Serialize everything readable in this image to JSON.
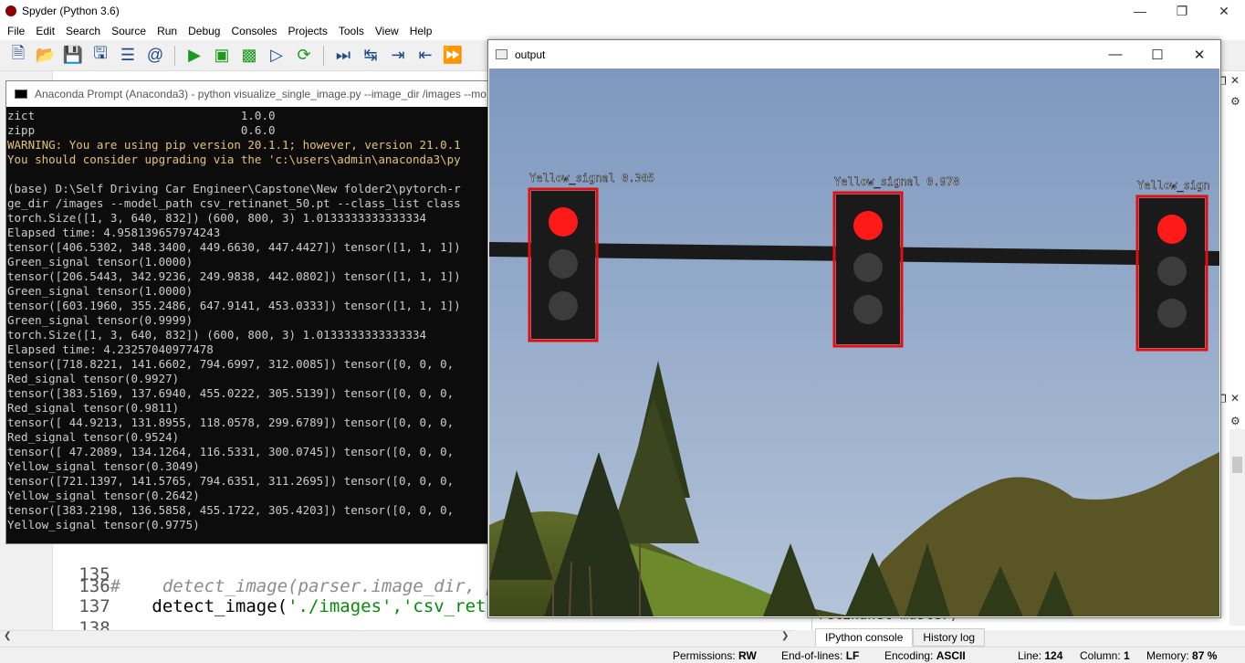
{
  "window": {
    "title": "Spyder (Python 3.6)",
    "controls": [
      "—",
      "❐",
      "✕"
    ]
  },
  "menu": [
    "File",
    "Edit",
    "Search",
    "Source",
    "Run",
    "Debug",
    "Consoles",
    "Projects",
    "Tools",
    "View",
    "Help"
  ],
  "editor": {
    "lines": [
      {
        "num": "135",
        "code": ""
      },
      {
        "num": "136",
        "code": "#    detect_image(parser.image_dir, parser.m"
      },
      {
        "num": "137",
        "code_prefix": "    detect_image(",
        "code_str": "'./images','csv_retinanet_",
        "code_suffix": ""
      },
      {
        "num": "138",
        "code": ""
      }
    ]
  },
  "prompt": {
    "title": "Anaconda Prompt (Anaconda3) - python  visualize_single_image.py --image_dir /images --mo",
    "lines": [
      {
        "text": "zict                              1.0.0",
        "warn": false
      },
      {
        "text": "zipp                              0.6.0",
        "warn": false
      },
      {
        "text": "WARNING: You are using pip version 20.1.1; however, version 21.0.1",
        "warn": true
      },
      {
        "text": "You should consider upgrading via the 'c:\\users\\admin\\anaconda3\\py",
        "warn": true
      },
      {
        "text": "",
        "warn": false
      },
      {
        "text": "(base) D:\\Self Driving Car Engineer\\Capstone\\New folder2\\pytorch-r",
        "warn": false
      },
      {
        "text": "ge_dir /images --model_path csv_retinanet_50.pt --class_list class",
        "warn": false
      },
      {
        "text": "torch.Size([1, 3, 640, 832]) (600, 800, 3) 1.0133333333333334",
        "warn": false
      },
      {
        "text": "Elapsed time: 4.958139657974243",
        "warn": false
      },
      {
        "text": "tensor([406.5302, 348.3400, 449.6630, 447.4427]) tensor([1, 1, 1])",
        "warn": false
      },
      {
        "text": "Green_signal tensor(1.0000)",
        "warn": false
      },
      {
        "text": "tensor([206.5443, 342.9236, 249.9838, 442.0802]) tensor([1, 1, 1])",
        "warn": false
      },
      {
        "text": "Green_signal tensor(1.0000)",
        "warn": false
      },
      {
        "text": "tensor([603.1960, 355.2486, 647.9141, 453.0333]) tensor([1, 1, 1])",
        "warn": false
      },
      {
        "text": "Green_signal tensor(0.9999)",
        "warn": false
      },
      {
        "text": "torch.Size([1, 3, 640, 832]) (600, 800, 3) 1.0133333333333334",
        "warn": false
      },
      {
        "text": "Elapsed time: 4.23257040977478",
        "warn": false
      },
      {
        "text": "tensor([718.8221, 141.6602, 794.6997, 312.0085]) tensor([0, 0, 0,",
        "warn": false
      },
      {
        "text": "Red_signal tensor(0.9927)",
        "warn": false
      },
      {
        "text": "tensor([383.5169, 137.6940, 455.0222, 305.5139]) tensor([0, 0, 0,",
        "warn": false
      },
      {
        "text": "Red_signal tensor(0.9811)",
        "warn": false
      },
      {
        "text": "tensor([ 44.9213, 131.8955, 118.0578, 299.6789]) tensor([0, 0, 0,",
        "warn": false
      },
      {
        "text": "Red_signal tensor(0.9524)",
        "warn": false
      },
      {
        "text": "tensor([ 47.2089, 134.1264, 116.5331, 300.0745]) tensor([0, 0, 0,",
        "warn": false
      },
      {
        "text": "Yellow_signal tensor(0.3049)",
        "warn": false
      },
      {
        "text": "tensor([721.1397, 141.5765, 794.6351, 311.2695]) tensor([0, 0, 0,",
        "warn": false
      },
      {
        "text": "Yellow_signal tensor(0.2642)",
        "warn": false
      },
      {
        "text": "tensor([383.2198, 136.5858, 455.1722, 305.4203]) tensor([0, 0, 0,",
        "warn": false
      },
      {
        "text": "Yellow_signal tensor(0.9775)",
        "warn": false
      }
    ]
  },
  "output": {
    "title": "output",
    "controls": [
      "—",
      "☐",
      "✕"
    ],
    "labels": [
      "Yellow_signal 0.305",
      "Yellow_signal 0.978",
      "Yellow_sign"
    ]
  },
  "console": {
    "tabs": [
      "IPython console",
      "History log"
    ],
    "behind_text": "retinanet-master)"
  },
  "status": {
    "permissions_label": "Permissions:",
    "permissions": "RW",
    "eol_label": "End-of-lines:",
    "eol": "LF",
    "encoding_label": "Encoding:",
    "encoding": "ASCII",
    "line_label": "Line:",
    "line": "124",
    "column_label": "Column:",
    "column": "1",
    "memory_label": "Memory:",
    "memory": "87 %"
  },
  "colors": {
    "box": "#e01010",
    "red_light": "#ff1a1a",
    "sky": "#8ea6c8",
    "warn": "#e5c07b"
  }
}
